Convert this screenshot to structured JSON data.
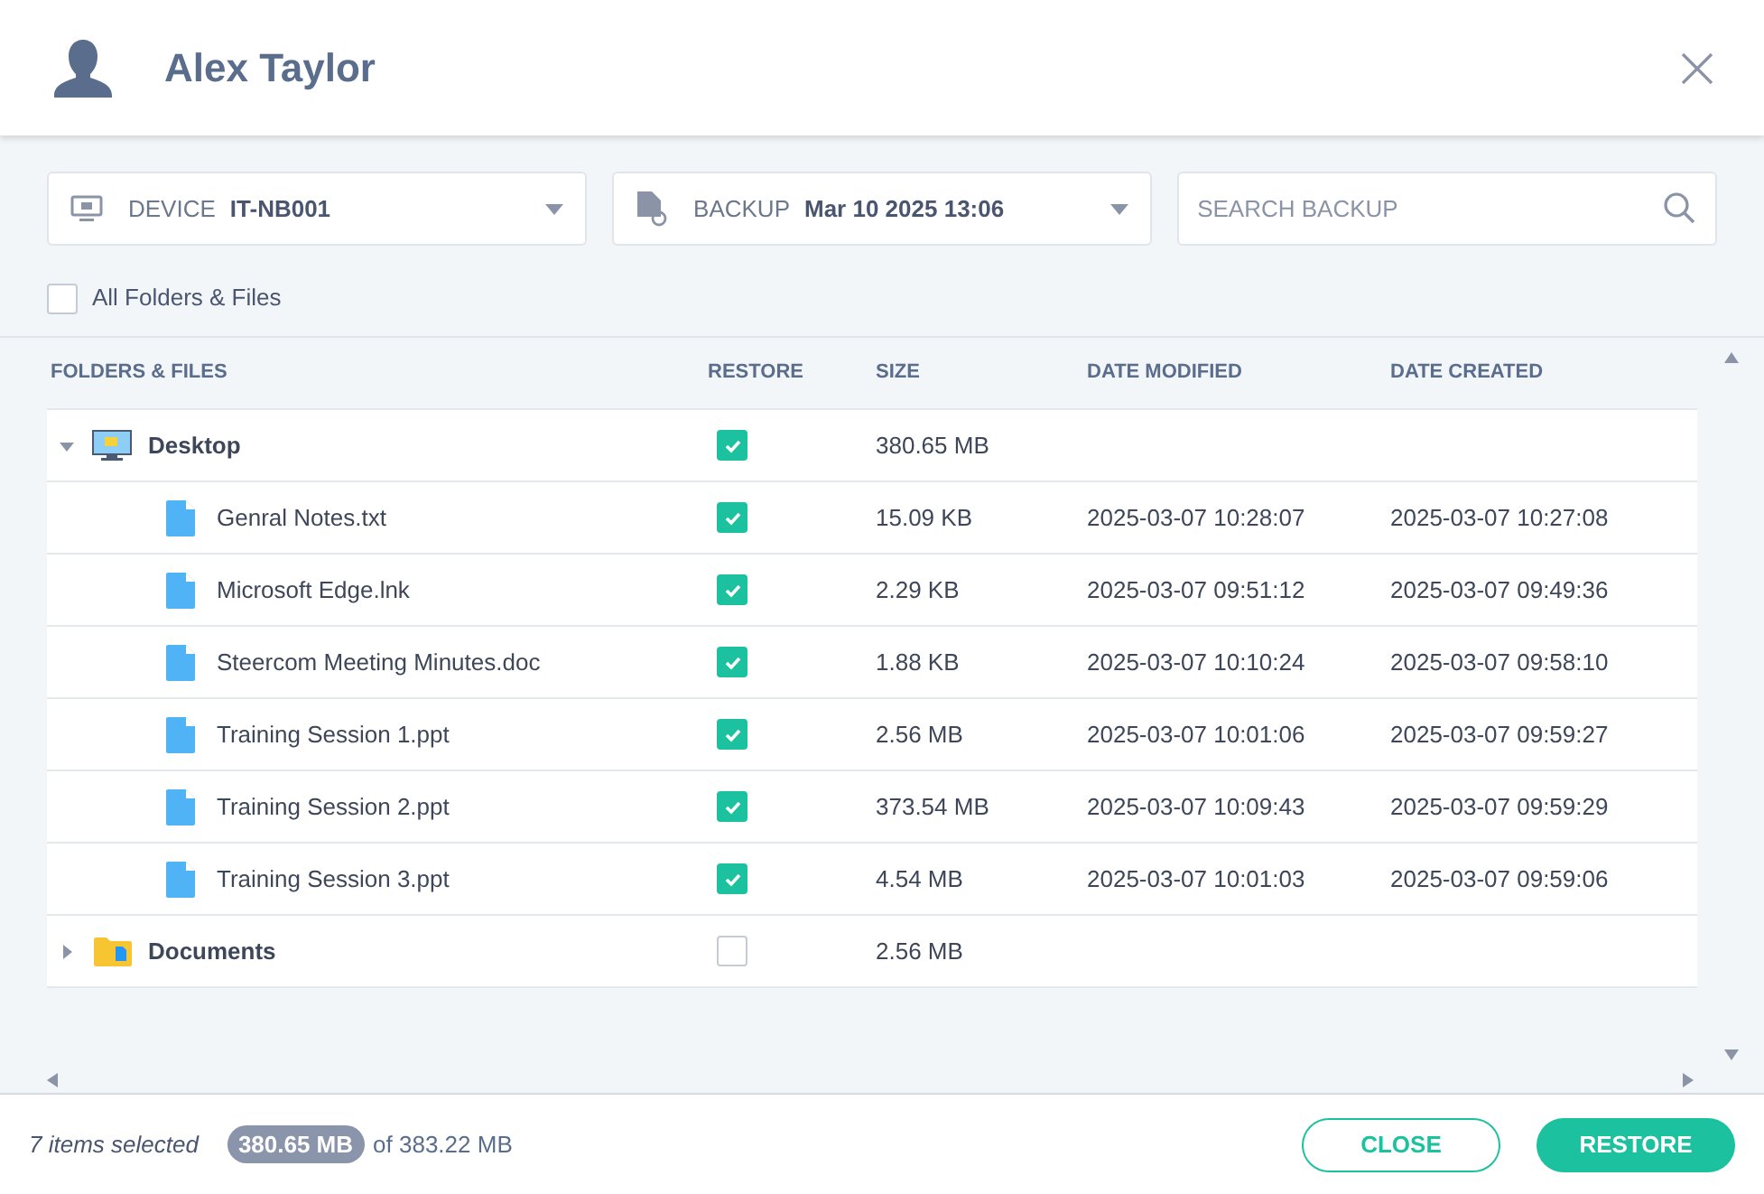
{
  "header": {
    "title": "Alex Taylor"
  },
  "device": {
    "label": "DEVICE",
    "value": "IT-NB001"
  },
  "backup": {
    "label": "BACKUP",
    "value": "Mar 10 2025 13:06"
  },
  "search": {
    "placeholder": "SEARCH BACKUP"
  },
  "all_checkbox": {
    "label": "All Folders & Files",
    "checked": false
  },
  "table": {
    "columns": [
      "FOLDERS & FILES",
      "RESTORE",
      "SIZE",
      "DATE MODIFIED",
      "DATE CREATED"
    ],
    "rows": [
      {
        "kind": "desktop",
        "name": "Desktop",
        "expanded": true,
        "checked": true,
        "size": "380.65 MB",
        "children": [
          {
            "kind": "file",
            "name": "Genral Notes.txt",
            "checked": true,
            "size": "15.09 KB",
            "modified": "2025-03-07 10:28:07",
            "created": "2025-03-07 10:27:08"
          },
          {
            "kind": "file",
            "name": "Microsoft Edge.lnk",
            "checked": true,
            "size": "2.29 KB",
            "modified": "2025-03-07 09:51:12",
            "created": "2025-03-07 09:49:36"
          },
          {
            "kind": "file",
            "name": "Steercom Meeting Minutes.doc",
            "checked": true,
            "size": "1.88 KB",
            "modified": "2025-03-07 10:10:24",
            "created": "2025-03-07 09:58:10"
          },
          {
            "kind": "file",
            "name": "Training Session 1.ppt",
            "checked": true,
            "size": "2.56 MB",
            "modified": "2025-03-07 10:01:06",
            "created": "2025-03-07 09:59:27"
          },
          {
            "kind": "file",
            "name": "Training Session 2.ppt",
            "checked": true,
            "size": "373.54 MB",
            "modified": "2025-03-07 10:09:43",
            "created": "2025-03-07 09:59:29"
          },
          {
            "kind": "file",
            "name": "Training Session 3.ppt",
            "checked": true,
            "size": "4.54 MB",
            "modified": "2025-03-07 10:01:03",
            "created": "2025-03-07 09:59:06"
          }
        ]
      },
      {
        "kind": "folder",
        "name": "Documents",
        "expanded": false,
        "checked": false,
        "size": "2.56 MB"
      }
    ]
  },
  "footer": {
    "selected_count": "7 items selected",
    "selected_size": "380.65 MB",
    "total": "of 383.22 MB",
    "buttons": [
      "CLOSE",
      "RESTORE"
    ]
  }
}
